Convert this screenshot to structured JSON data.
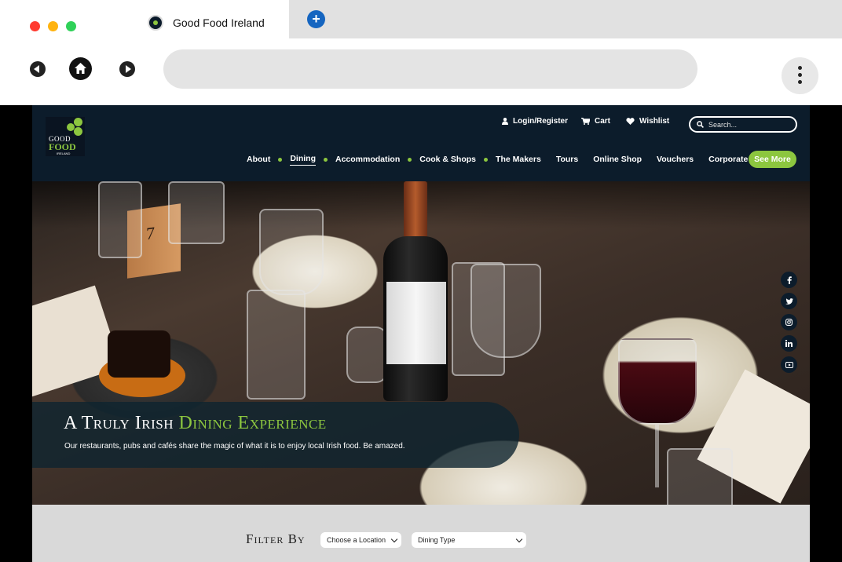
{
  "browser": {
    "tab_title": "Good Food Ireland",
    "new_tab_label": "+",
    "url": ""
  },
  "logo": {
    "line1": "GOOD",
    "line2": "FOOD",
    "line3": "IRELAND"
  },
  "util_nav": {
    "login": "Login/Register",
    "cart": "Cart",
    "wishlist": "Wishlist",
    "search_placeholder": "Search..."
  },
  "main_nav": {
    "items": [
      "About",
      "Dining",
      "Accommodation",
      "Cook & Shops",
      "The Makers",
      "Tours",
      "Online Shop",
      "Vouchers",
      "Corporate"
    ],
    "see_more": "See More"
  },
  "hero": {
    "title_white": "A Truly Irish",
    "title_green": "Dining Experience",
    "subtitle": "Our restaurants, pubs and cafés share the magic of what it is to enjoy local Irish food. Be amazed.",
    "table_number": "7"
  },
  "social": [
    "f",
    "t",
    "ig",
    "in",
    "yt"
  ],
  "filter": {
    "label": "Filter By",
    "location_value": "Choose a Location",
    "type_value": "Dining Type"
  },
  "colors": {
    "brand_dark": "#0c1c2b",
    "brand_green": "#8cc63f"
  }
}
